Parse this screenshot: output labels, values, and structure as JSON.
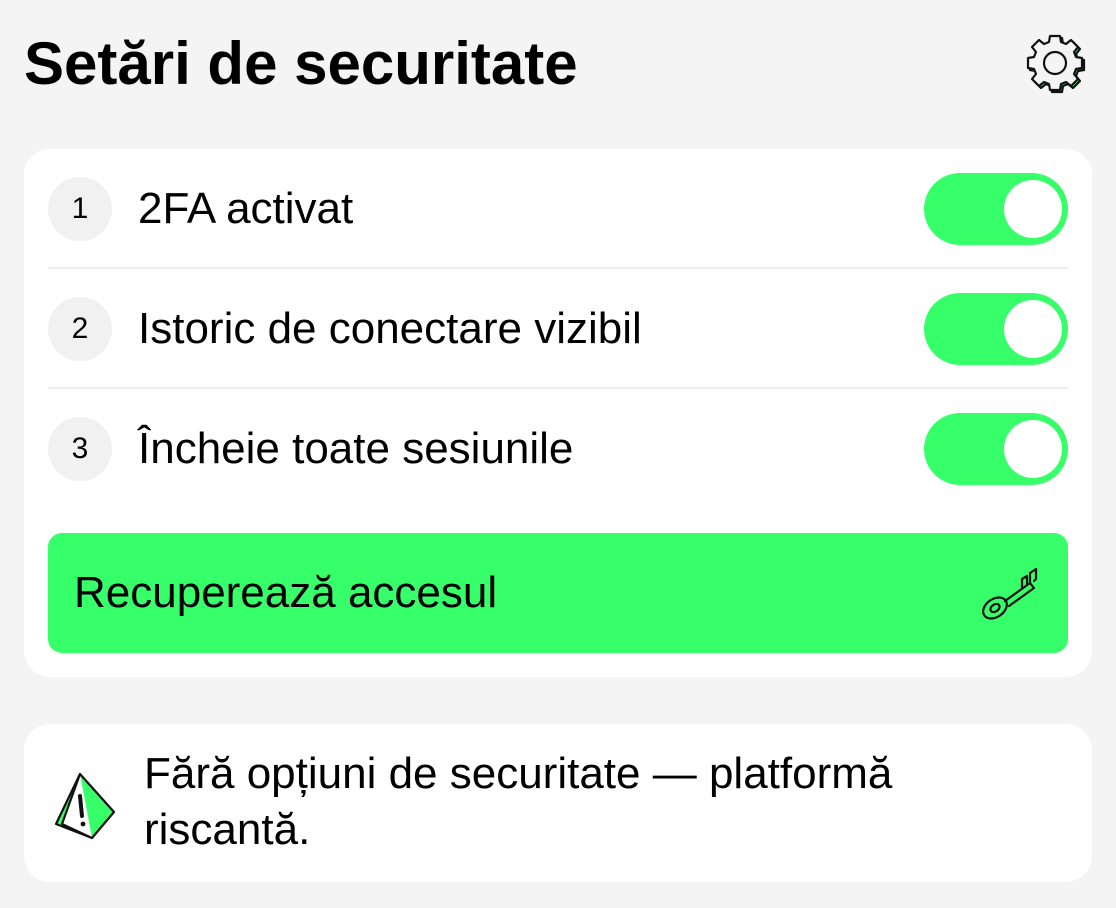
{
  "header": {
    "title": "Setări de securitate",
    "settings_icon": "gear-icon"
  },
  "settings": [
    {
      "number": "1",
      "label": "2FA activat",
      "enabled": true
    },
    {
      "number": "2",
      "label": "Istoric de conectare vizibil",
      "enabled": true
    },
    {
      "number": "3",
      "label": "Încheie toate sesiunile",
      "enabled": true
    }
  ],
  "recover": {
    "label": "Recuperează accesul",
    "icon": "key-icon"
  },
  "warning": {
    "icon": "warning-icon",
    "text": "Fără opțiuni de securitate — platformă riscantă."
  },
  "colors": {
    "accent": "#36ff6a",
    "background": "#f4f4f4",
    "card": "#ffffff"
  }
}
